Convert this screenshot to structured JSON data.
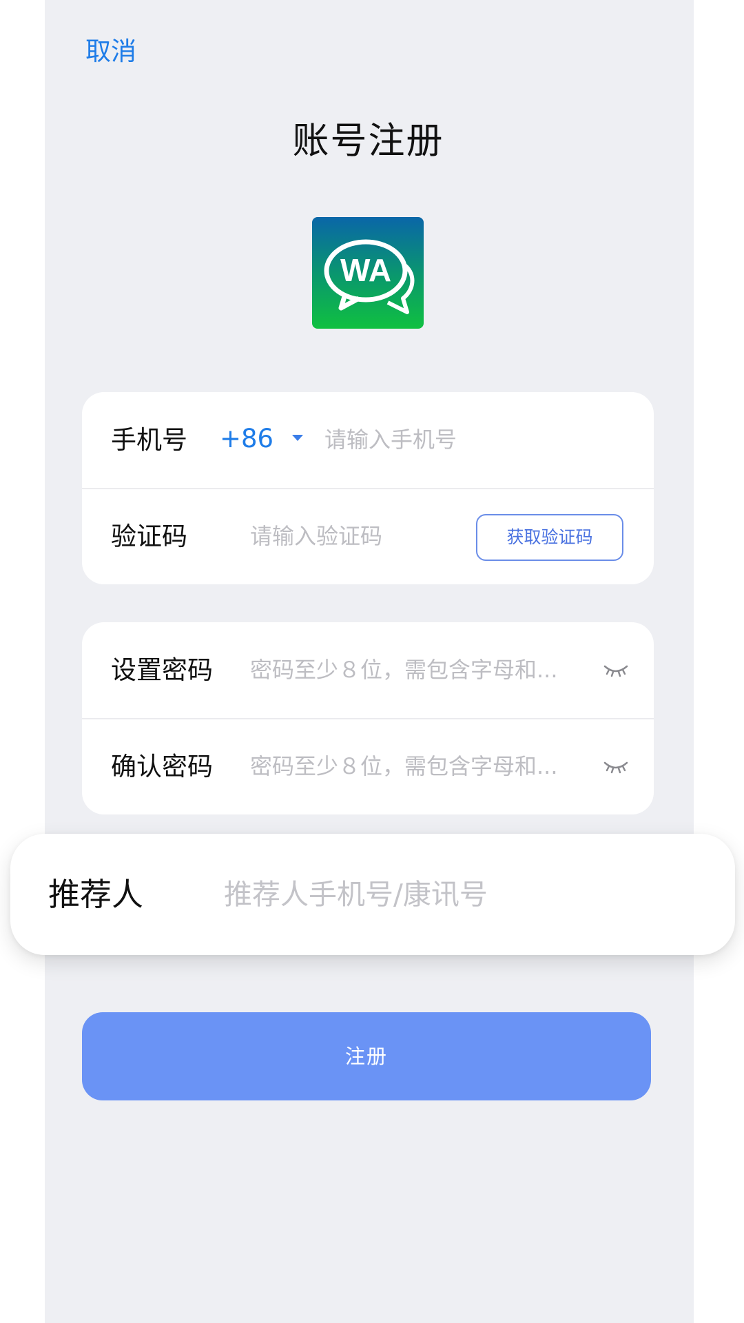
{
  "header": {
    "cancel_label": "取消",
    "title": "账号注册"
  },
  "logo": {
    "text": "WA",
    "gradient_top": "#0a66a8",
    "gradient_bottom": "#10c040"
  },
  "phone_row": {
    "label": "手机号",
    "country_code": "+86",
    "placeholder": "请输入手机号"
  },
  "code_row": {
    "label": "验证码",
    "placeholder": "请输入验证码",
    "button_label": "获取验证码"
  },
  "password_row": {
    "label": "设置密码",
    "placeholder": "密码至少８位，需包含字母和...",
    "icon": "eye-closed-icon"
  },
  "confirm_row": {
    "label": "确认密码",
    "placeholder": "密码至少８位，需包含字母和...",
    "icon": "eye-closed-icon"
  },
  "referrer_row": {
    "label": "推荐人",
    "placeholder": "推荐人手机号/康讯号"
  },
  "submit": {
    "label": "注册",
    "color": "#6a93f5"
  },
  "colors": {
    "accent": "#1e7ce8",
    "background": "#eeeff3"
  }
}
